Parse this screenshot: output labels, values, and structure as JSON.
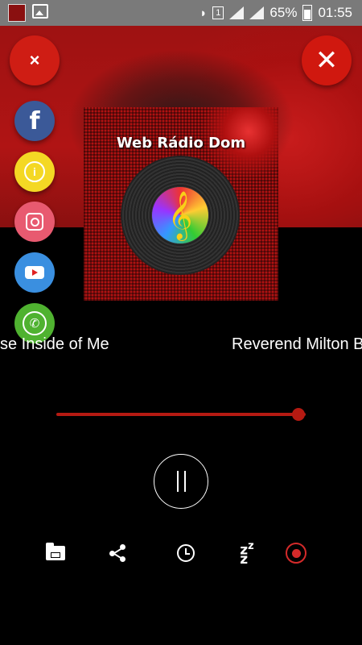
{
  "status_bar": {
    "sim_slot": "1",
    "battery": "65%",
    "time": "01:55"
  },
  "header": {
    "menu_close_symbol": "×",
    "close_symbol": "✕"
  },
  "social": [
    {
      "name": "facebook",
      "icon": "facebook-icon",
      "color": "#3b5998",
      "glyph": "f"
    },
    {
      "name": "info",
      "icon": "info-icon",
      "color": "#f4d824",
      "glyph": "i"
    },
    {
      "name": "instagram",
      "icon": "instagram-icon",
      "color": "#e85a70"
    },
    {
      "name": "youtube",
      "icon": "youtube-icon",
      "color": "#3a8fe0"
    },
    {
      "name": "whatsapp",
      "icon": "whatsapp-icon",
      "color": "#4fb230",
      "glyph": "✆"
    }
  ],
  "album": {
    "title": "Web Rádio Dom",
    "clef": "𝄞"
  },
  "now_playing": {
    "song_fragment": "se Inside of Me",
    "artist_fragment": "Reverend Milton B"
  },
  "progress": {
    "fraction": 0.97,
    "color": "#b51a12"
  },
  "toolbar": {
    "sleep_glyph": "z z\nz"
  },
  "colors": {
    "accent": "#d0180f",
    "background": "#000000"
  }
}
